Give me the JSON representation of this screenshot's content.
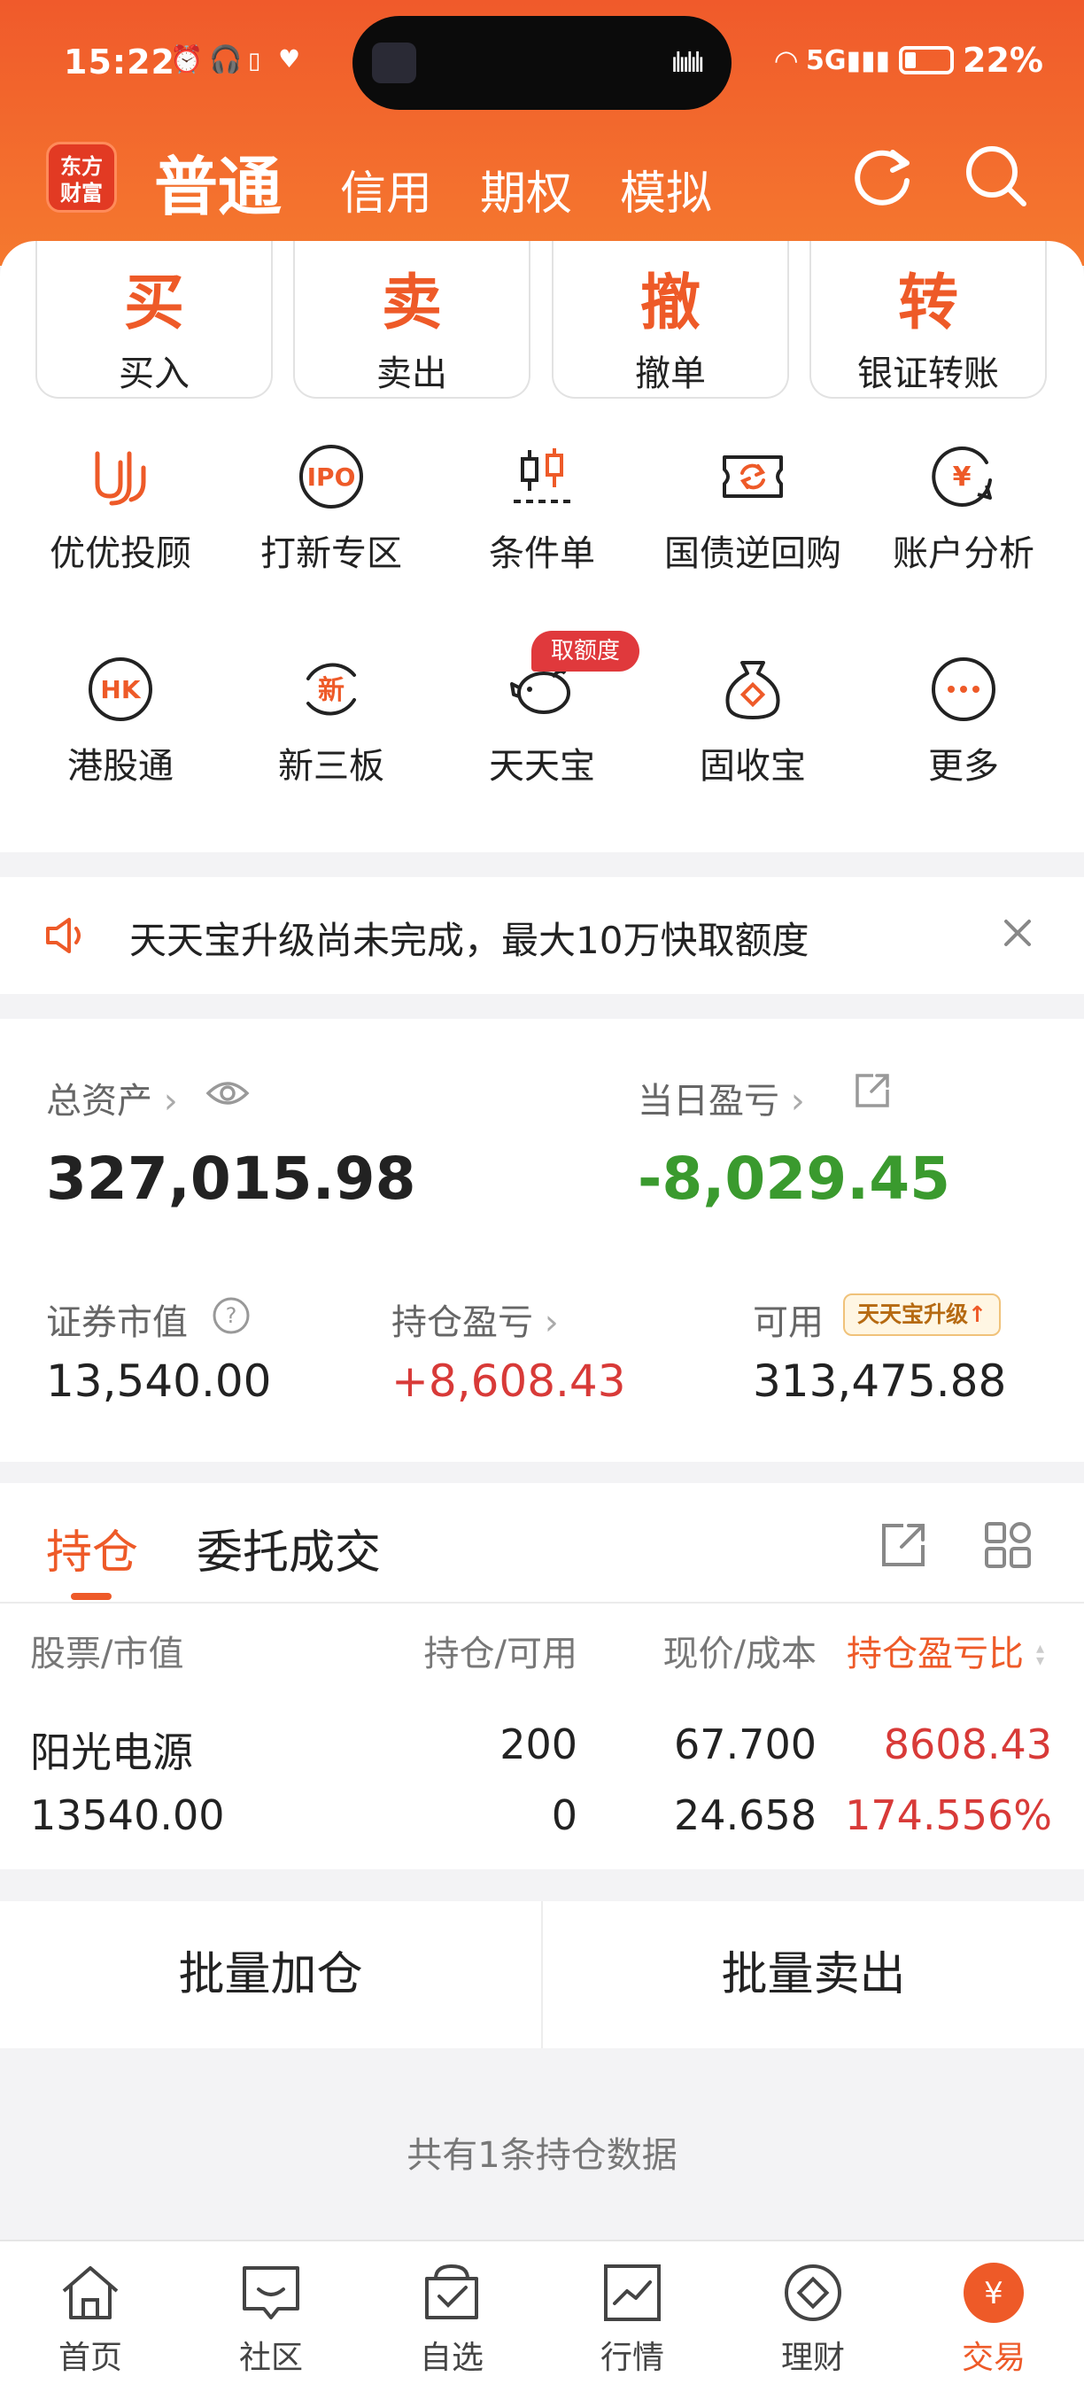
{
  "status_bar": {
    "time": "15:22",
    "network": "5G",
    "battery": "22%"
  },
  "header": {
    "logo_line1": "东方",
    "logo_line2": "财富",
    "tabs": [
      {
        "label": "普通",
        "active": true
      },
      {
        "label": "信用"
      },
      {
        "label": "期权"
      },
      {
        "label": "模拟"
      }
    ],
    "icons": [
      "refresh-icon",
      "search-icon"
    ]
  },
  "actions": [
    {
      "glyph": "买",
      "label": "买入"
    },
    {
      "glyph": "卖",
      "label": "卖出"
    },
    {
      "glyph": "撤",
      "label": "撤单"
    },
    {
      "glyph": "转",
      "label": "银证转账"
    }
  ],
  "grid": [
    {
      "label": "优优投顾",
      "icon": "uu-icon"
    },
    {
      "label": "打新专区",
      "icon": "ipo-icon",
      "icon_text": "IPO"
    },
    {
      "label": "条件单",
      "icon": "candlestick-icon"
    },
    {
      "label": "国债逆回购",
      "icon": "repo-icon"
    },
    {
      "label": "账户分析",
      "icon": "yuan-chat-icon",
      "icon_text": "¥"
    },
    {
      "label": "港股通",
      "icon": "hk-icon",
      "icon_text": "HK"
    },
    {
      "label": "新三板",
      "icon": "xin-icon",
      "icon_text": "新"
    },
    {
      "label": "天天宝",
      "icon": "piggy-bank-icon",
      "badge": "取额度"
    },
    {
      "label": "固收宝",
      "icon": "money-bag-icon"
    },
    {
      "label": "更多",
      "icon": "more-icon"
    }
  ],
  "notice": {
    "text": "天天宝升级尚未完成，最大10万快取额度"
  },
  "assets": {
    "total_label": "总资产",
    "total_value": "327,015.98",
    "daily_pnl_label": "当日盈亏",
    "daily_pnl_value": "-8,029.45",
    "market_value_label": "证券市值",
    "market_value": "13,540.00",
    "position_pnl_label": "持仓盈亏",
    "position_pnl_value": "+8,608.43",
    "available_label": "可用",
    "available_badge": "天天宝升级",
    "available_value": "313,475.88",
    "colors": {
      "down": "#3a9a2e",
      "up": "#d83a38"
    }
  },
  "holdings": {
    "tabs": [
      {
        "label": "持仓",
        "active": true
      },
      {
        "label": "委托成交"
      }
    ],
    "columns": [
      "股票/市值",
      "持仓/可用",
      "现价/成本",
      "持仓盈亏比"
    ],
    "rows": [
      {
        "name": "阳光电源",
        "market_value": "13540.00",
        "position": "200",
        "available": "0",
        "price": "67.700",
        "cost": "24.658",
        "pnl": "8608.43",
        "pnl_ratio": "174.556%"
      }
    ]
  },
  "batch": {
    "add_label": "批量加仓",
    "sell_label": "批量卖出"
  },
  "summary": "共有1条持仓数据",
  "bottom_nav": [
    {
      "label": "首页",
      "icon": "home-icon"
    },
    {
      "label": "社区",
      "icon": "community-icon"
    },
    {
      "label": "自选",
      "icon": "watchlist-icon"
    },
    {
      "label": "行情",
      "icon": "market-icon"
    },
    {
      "label": "理财",
      "icon": "finance-icon"
    },
    {
      "label": "交易",
      "icon": "trade-icon",
      "icon_text": "¥",
      "active": true
    }
  ],
  "accent_color": "#ee5a28"
}
